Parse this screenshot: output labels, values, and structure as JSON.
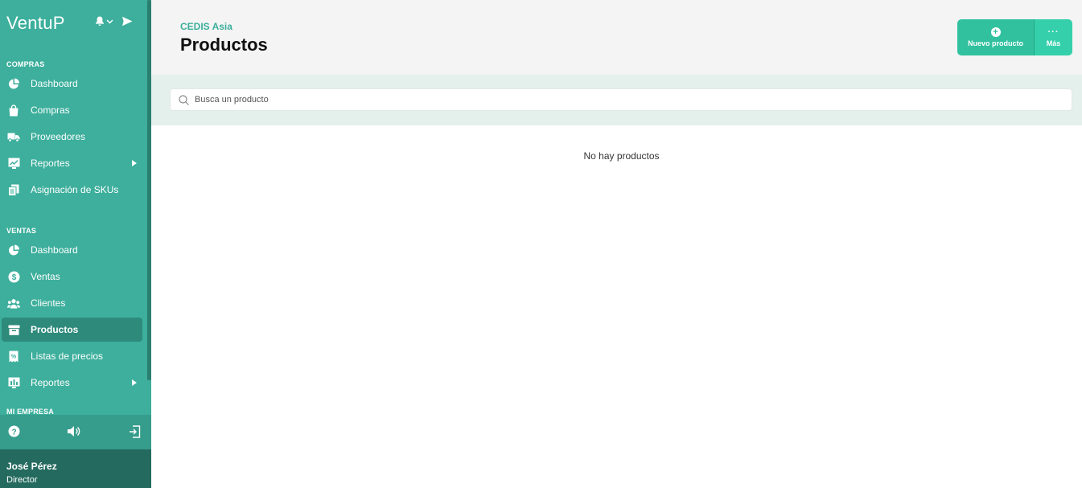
{
  "app": {
    "logo": "VentuP"
  },
  "sidebar": {
    "sections": [
      {
        "label": "COMPRAS",
        "items": [
          {
            "label": "Dashboard",
            "icon": "pie-chart-icon"
          },
          {
            "label": "Compras",
            "icon": "shopping-bag-icon"
          },
          {
            "label": "Proveedores",
            "icon": "truck-icon"
          },
          {
            "label": "Reportes",
            "icon": "report-chart-icon"
          },
          {
            "label": "Asignación de SKUs",
            "icon": "documents-icon"
          }
        ]
      },
      {
        "label": "VENTAS",
        "items": [
          {
            "label": "Dashboard",
            "icon": "pie-chart-icon"
          },
          {
            "label": "Ventas",
            "icon": "dollar-circle-icon"
          },
          {
            "label": "Clientes",
            "icon": "users-icon"
          },
          {
            "label": "Productos",
            "icon": "archive-box-icon"
          },
          {
            "label": "Listas de precios",
            "icon": "price-list-icon"
          },
          {
            "label": "Reportes",
            "icon": "report-chart-icon"
          }
        ]
      },
      {
        "label": "MI EMPRESA",
        "items": []
      }
    ],
    "active_item": "Productos",
    "user": {
      "name": "José Pérez",
      "role": "Director"
    }
  },
  "header": {
    "breadcrumb": "CEDIS Asia",
    "title": "Productos",
    "new_button_label": "Nuevo producto",
    "more_button_label": "Más"
  },
  "search": {
    "placeholder": "Busca un producto",
    "value": ""
  },
  "main": {
    "empty_message": "No hay productos"
  },
  "colors": {
    "sidebar_bg": "#3daf9c",
    "active_bg": "#2e8a7b",
    "user_bg": "#246a5f",
    "accent": "#32c19f",
    "breadcrumb": "#3daf9c"
  }
}
